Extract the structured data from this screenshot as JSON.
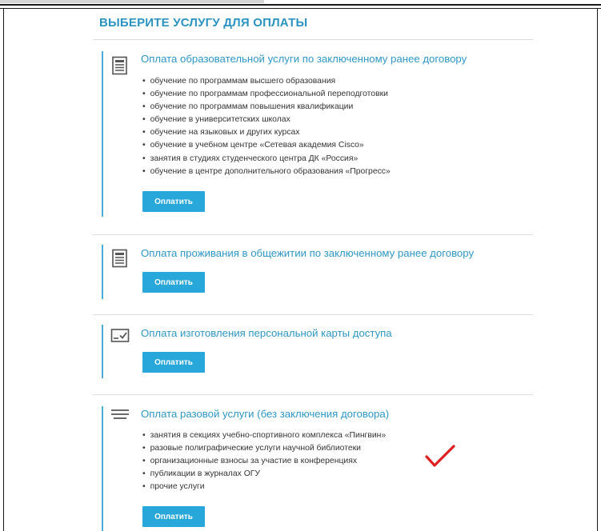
{
  "page_title": "ВЫБЕРИТЕ УСЛУГУ ДЛЯ ОПЛАТЫ",
  "colors": {
    "accent": "#2a93c2",
    "button": "#28a7da",
    "bar": "#49aed8",
    "check": "#e02020"
  },
  "services": [
    {
      "icon": "document-icon",
      "title": "Оплата образовательной услуги по заключенному ранее договору",
      "items": [
        "обучение по программам высшего образования",
        "обучение по программам профессиональной переподготовки",
        "обучение по программам повышения квалификации",
        "обучение в университетских школах",
        "обучение на языковых и других курсах",
        "обучение в учебном центре «Сетевая академия Cisco»",
        "занятия в студиях студенческого центра ДК «Россия»",
        "обучение в центре дополнительного образования «Прогресс»"
      ],
      "button_label": "Оплатить"
    },
    {
      "icon": "document-icon",
      "title": "Оплата проживания в общежитии по заключенному ранее договору",
      "items": [],
      "button_label": "Оплатить"
    },
    {
      "icon": "id-card-icon",
      "title": "Оплата изготовления персональной карты доступа",
      "items": [],
      "button_label": "Оплатить"
    },
    {
      "icon": "menu-lines-icon",
      "title": "Оплата разовой услуги (без заключения договора)",
      "items": [
        "занятия в секциях учебно-спортивного комплекса «Пингвин»",
        "разовые полиграфические услуги научной библиотеки",
        "организационные взносы за участие в конференциях",
        "публикации в журналах ОГУ",
        "прочие услуги"
      ],
      "button_label": "Оплатить"
    }
  ]
}
